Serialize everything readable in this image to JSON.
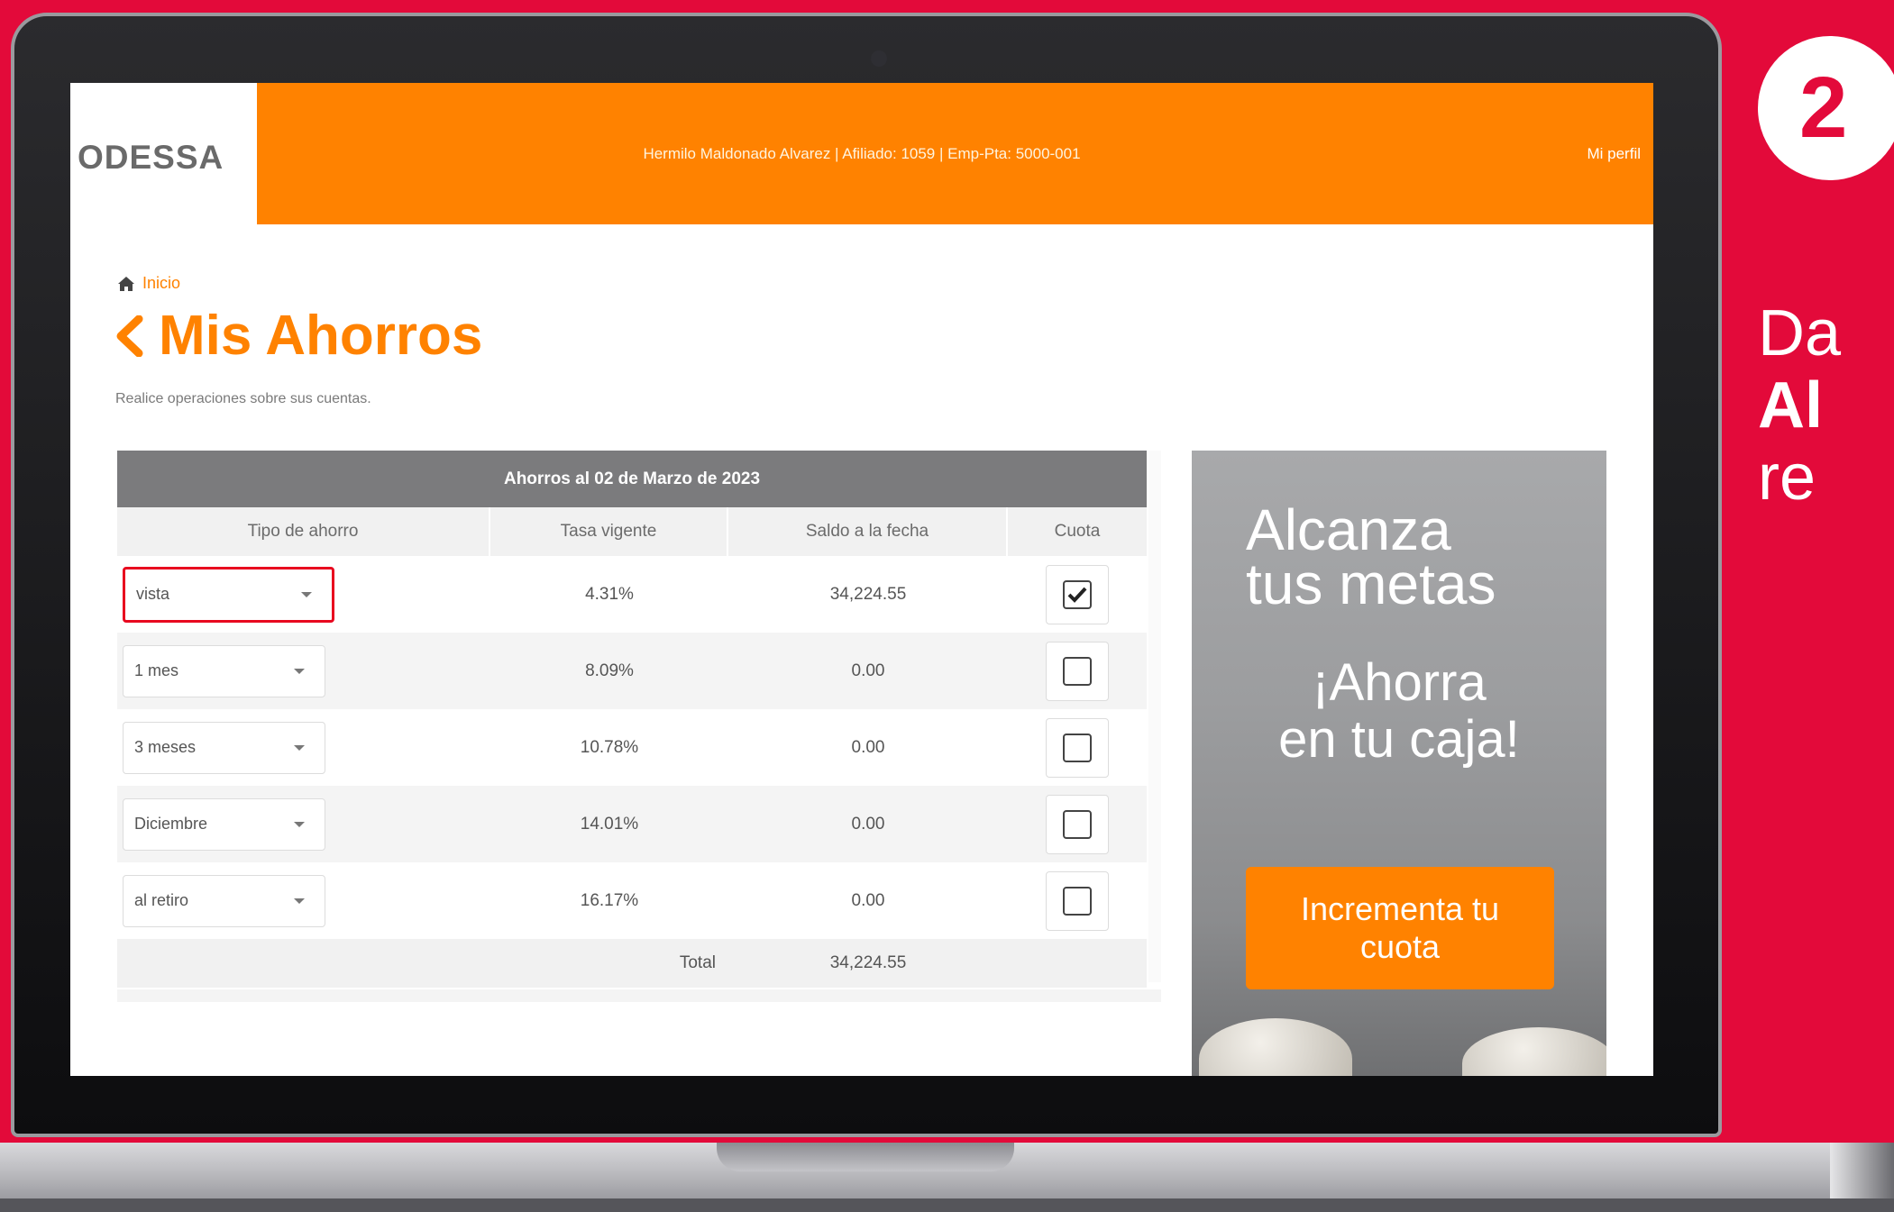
{
  "header": {
    "logo": "ODESSA",
    "user_info": "Hermilo Maldonado Alvarez | Afiliado: 1059 | Emp-Pta: 5000-001",
    "profile_link": "Mi perfil"
  },
  "breadcrumb": {
    "home": "Inicio"
  },
  "page": {
    "title": "Mis Ahorros",
    "subtitle": "Realice operaciones sobre sus cuentas."
  },
  "table": {
    "caption": "Ahorros al 02 de Marzo de 2023",
    "columns": [
      "Tipo de ahorro",
      "Tasa vigente",
      "Saldo a la fecha",
      "Cuota"
    ],
    "rows": [
      {
        "tipo": "vista",
        "tasa": "4.31%",
        "saldo": "34,224.55",
        "cuota": true
      },
      {
        "tipo": "1 mes",
        "tasa": "8.09%",
        "saldo": "0.00",
        "cuota": false
      },
      {
        "tipo": "3 meses",
        "tasa": "10.78%",
        "saldo": "0.00",
        "cuota": false
      },
      {
        "tipo": "Diciembre",
        "tasa": "14.01%",
        "saldo": "0.00",
        "cuota": false
      },
      {
        "tipo": "al retiro",
        "tasa": "16.17%",
        "saldo": "0.00",
        "cuota": false
      }
    ],
    "total_label": "Total",
    "total_value": "34,224.55"
  },
  "ad": {
    "line1": "Alcanza",
    "line2": "tus metas",
    "line3": "¡Ahorra",
    "line4": "en tu caja!",
    "button": "Incrementa tu cuota"
  },
  "side": {
    "step": "2",
    "line1": "Da",
    "line2": "Al",
    "line3": "re"
  },
  "colors": {
    "brand_orange": "#ff8200",
    "background_red": "#e30a3a",
    "highlight_red": "#e8081f"
  },
  "icons": [
    "home-icon",
    "chevron-left-icon",
    "caret-down-icon",
    "check-icon"
  ]
}
